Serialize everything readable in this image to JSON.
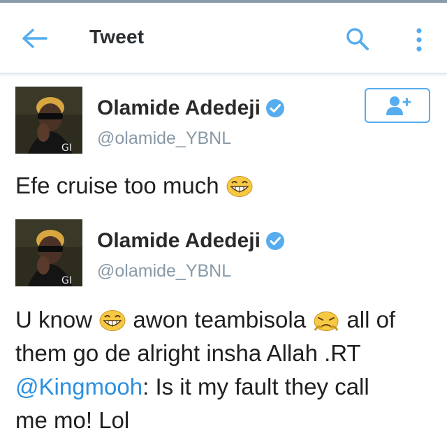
{
  "header": {
    "title": "Tweet",
    "back_icon": "back-arrow-icon",
    "search_icon": "search-icon",
    "more_icon": "more-vertical-icon",
    "accent_color": "#55acee"
  },
  "tweets": [
    {
      "author": {
        "display_name": "Olamide Adedeji",
        "handle": "@olamide_YBNL",
        "verified": true,
        "avatar_watermark": "GI"
      },
      "follow_icon": "add-user-icon",
      "text": "Efe cruise too much",
      "emojis": [
        "laughing-face-emoji"
      ]
    },
    {
      "author": {
        "display_name": "Olamide Adedeji",
        "handle": "@olamide_YBNL",
        "verified": true,
        "avatar_watermark": "GI"
      },
      "text_line1_a": "U know",
      "text_line1_b": "awon teambisola",
      "text_line1_c": "all of",
      "text_line2": "them go de alright insha Allah .RT",
      "mention": "@Kingmooh",
      "text_line3_rest": ": Is it my fault they call",
      "text_line4": "me mo! Lol",
      "emojis": [
        "laughing-face-emoji",
        "pouting-face-emoji"
      ]
    }
  ]
}
